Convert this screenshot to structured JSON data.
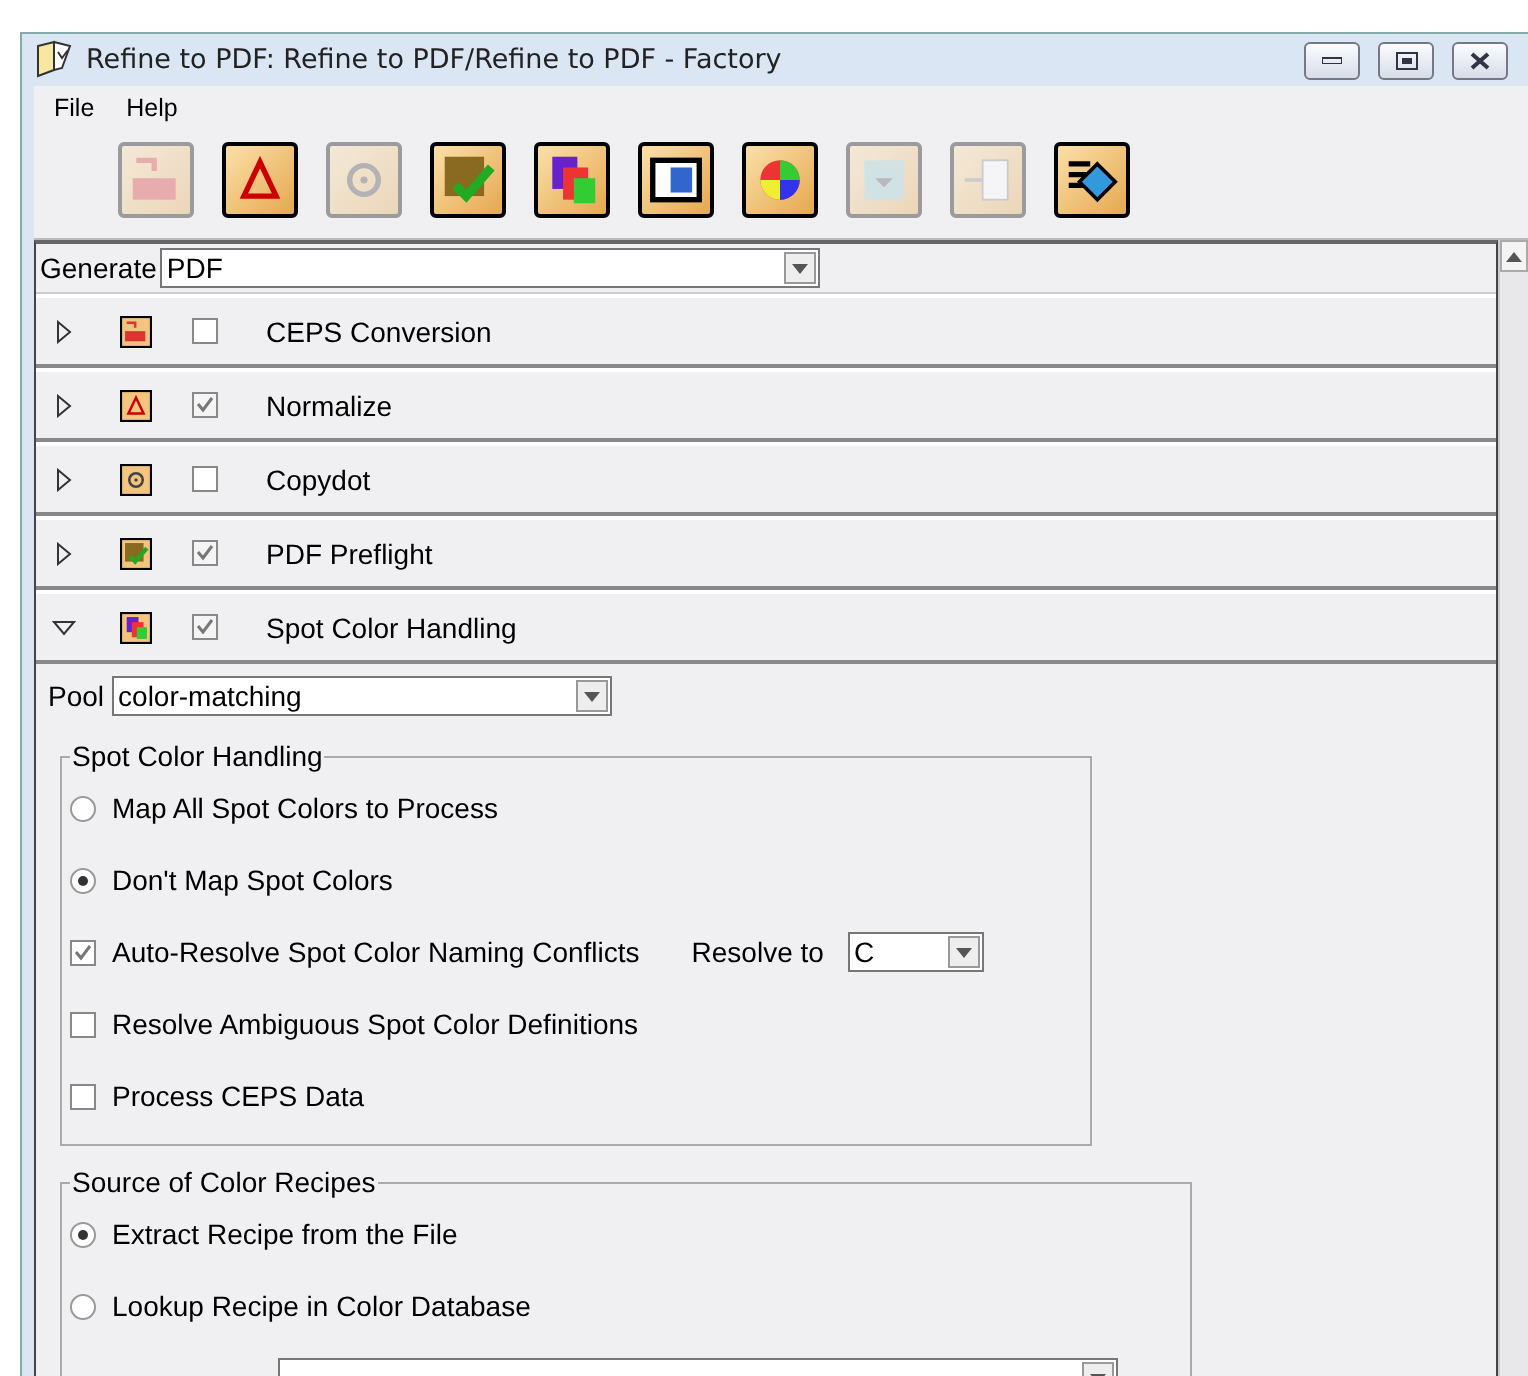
{
  "window": {
    "title": "Refine to PDF: Refine to PDF/Refine to PDF - Factory"
  },
  "menu": [
    "File",
    "Help"
  ],
  "toolbar": [
    {
      "kind": "ceps",
      "disabled": true
    },
    {
      "kind": "normalize",
      "disabled": false
    },
    {
      "kind": "copydot",
      "disabled": true
    },
    {
      "kind": "preflight",
      "disabled": false
    },
    {
      "kind": "spot",
      "disabled": false
    },
    {
      "kind": "screen",
      "disabled": false
    },
    {
      "kind": "color",
      "disabled": false
    },
    {
      "kind": "impose",
      "disabled": true
    },
    {
      "kind": "merge",
      "disabled": true
    },
    {
      "kind": "output",
      "disabled": false
    }
  ],
  "generate": {
    "label": "Generate",
    "value": "PDF"
  },
  "sections": [
    {
      "kind": "ceps",
      "name": "CEPS Conversion",
      "expanded": false,
      "checked": false
    },
    {
      "kind": "normalize",
      "name": "Normalize",
      "expanded": false,
      "checked": true
    },
    {
      "kind": "copydot",
      "name": "Copydot",
      "expanded": false,
      "checked": false
    },
    {
      "kind": "preflight",
      "name": "PDF Preflight",
      "expanded": false,
      "checked": true
    },
    {
      "kind": "spot",
      "name": "Spot Color Handling",
      "expanded": true,
      "checked": true
    }
  ],
  "pool": {
    "label": "Pool",
    "value": "color-matching"
  },
  "spot_group": {
    "title": "Spot Color Handling",
    "options": [
      {
        "kind": "radio",
        "label": "Map All Spot Colors to Process",
        "selected": false
      },
      {
        "kind": "radio",
        "label": "Don't Map Spot Colors",
        "selected": true
      },
      {
        "kind": "checkbox",
        "label": "Auto-Resolve Spot Color Naming Conflicts",
        "checked": true,
        "resolve": {
          "label": "Resolve to",
          "value": "C"
        }
      },
      {
        "kind": "checkbox",
        "label": "Resolve Ambiguous Spot Color Definitions",
        "checked": false
      },
      {
        "kind": "checkbox",
        "label": "Process CEPS Data",
        "checked": false
      }
    ]
  },
  "source_group": {
    "title": "Source of Color Recipes",
    "options": [
      {
        "kind": "radio",
        "label": "Extract Recipe from the File",
        "selected": true
      },
      {
        "kind": "radio",
        "label": "Lookup Recipe in Color Database",
        "selected": false
      },
      {
        "kind": "field"
      }
    ]
  }
}
